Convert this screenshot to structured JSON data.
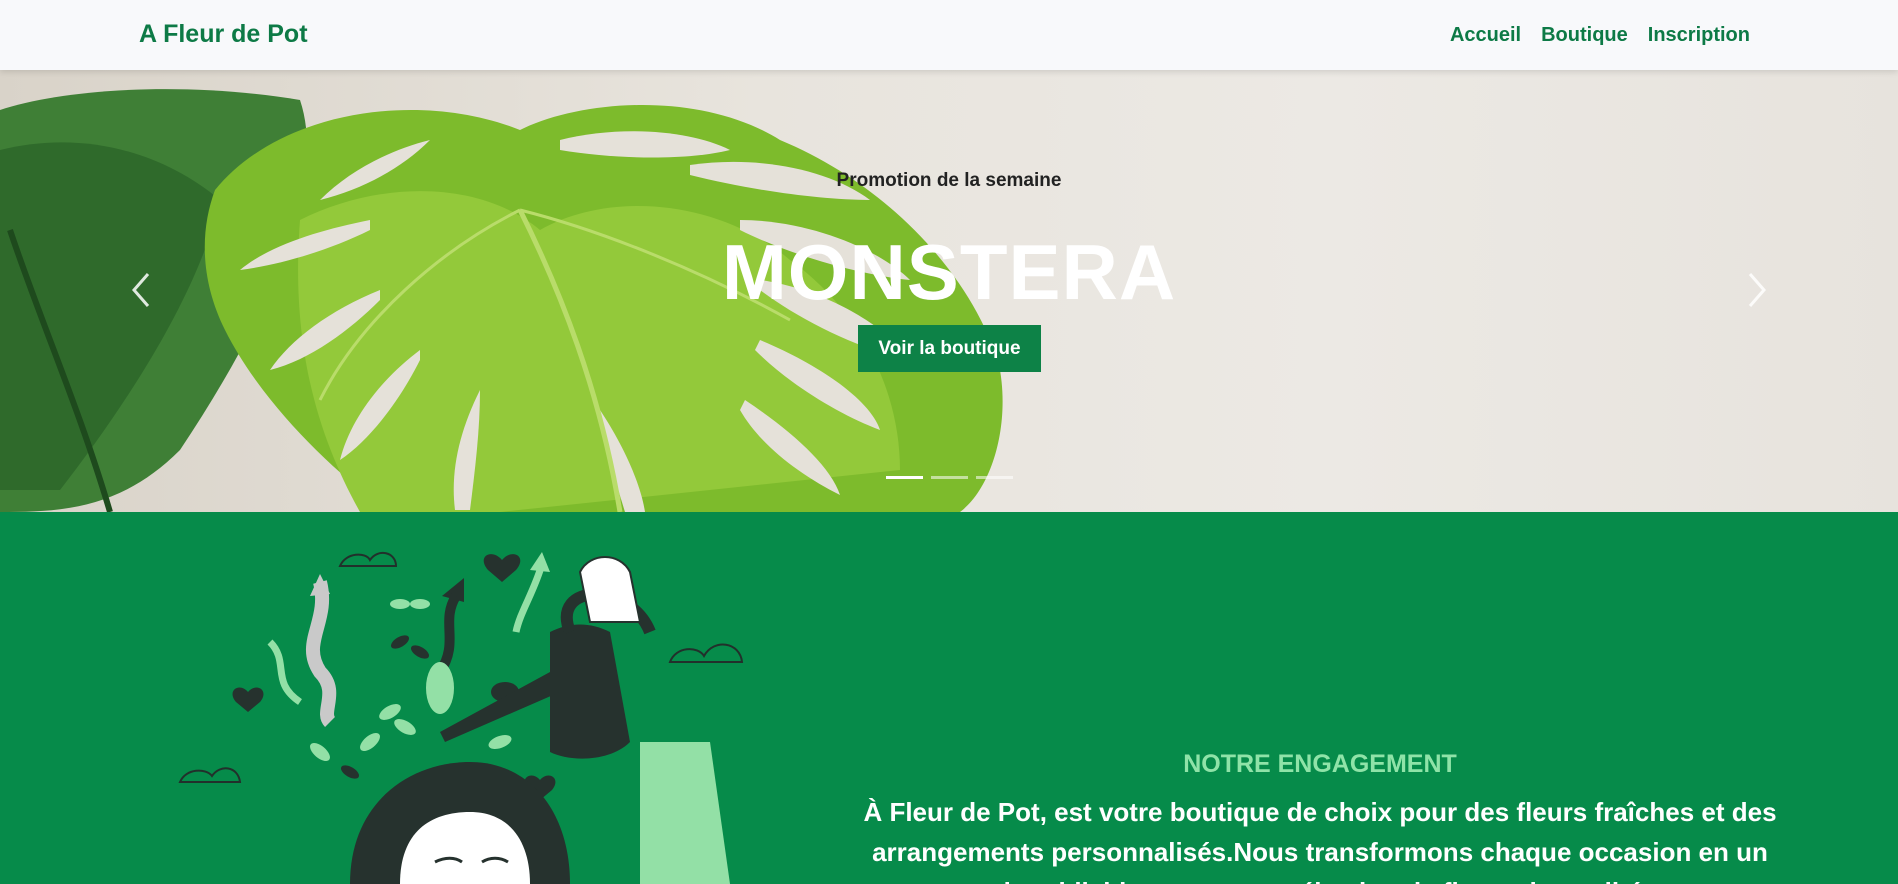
{
  "navbar": {
    "brand": "A Fleur de Pot",
    "links": [
      "Accueil",
      "Boutique",
      "Inscription"
    ]
  },
  "hero": {
    "subtitle": "Promotion de la semaine",
    "title": "MONSTERA",
    "button_label": "Voir la boutique",
    "prev_icon": "chevron-left-icon",
    "next_icon": "chevron-right-icon",
    "slides_count": 3,
    "active_slide": 1
  },
  "engagement": {
    "title": "NOTRE ENGAGEMENT",
    "text": "À Fleur de Pot, est votre boutique de choix pour des fleurs fraîches et des arrangements personnalisés.Nous transformons chaque occasion en un moment inoubliable avec notre sélection de fleurs de qualité et notre"
  },
  "colors": {
    "brand_green": "#0d7a46",
    "section_green": "#068b4a",
    "accent_light_green": "#8fe3a8"
  }
}
